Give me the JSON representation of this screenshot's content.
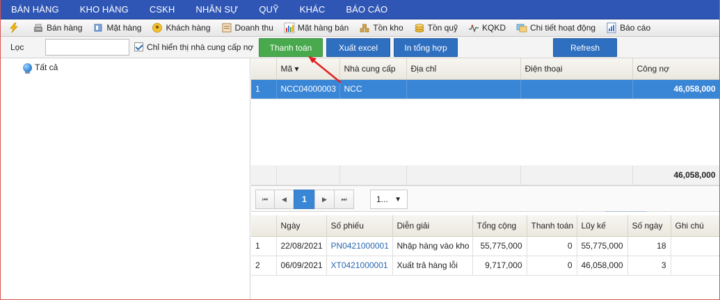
{
  "menu": [
    "BÁN HÀNG",
    "KHO HÀNG",
    "CSKH",
    "NHÂN SỰ",
    "QUỸ",
    "KHÁC",
    "BÁO CÁO"
  ],
  "toolbar": [
    {
      "label": "",
      "icon": "lightning-icon"
    },
    {
      "label": "Bán hàng",
      "icon": "cash-register-icon"
    },
    {
      "label": "Mặt hàng",
      "icon": "product-box-icon"
    },
    {
      "label": "Khách hàng",
      "icon": "customer-icon"
    },
    {
      "label": "Doanh thu",
      "icon": "revenue-icon"
    },
    {
      "label": "Mặt hàng bán",
      "icon": "sales-chart-icon"
    },
    {
      "label": "Tồn kho",
      "icon": "stock-icon"
    },
    {
      "label": "Tồn quỹ",
      "icon": "coins-icon"
    },
    {
      "label": "KQKD",
      "icon": "business-result-icon"
    },
    {
      "label": "Chi tiết hoạt động",
      "icon": "activity-icon"
    },
    {
      "label": "Báo cáo",
      "icon": "report-icon"
    }
  ],
  "filter": {
    "label": "Lọc",
    "value": "",
    "checkbox_label": "Chỉ hiển thị nhà cung cấp nợ",
    "checkbox_checked": true,
    "btn_pay": "Thanh toán",
    "btn_excel": "Xuất excel",
    "btn_print": "In tổng hợp",
    "btn_refresh": "Refresh"
  },
  "tree": {
    "root": "Tất cả"
  },
  "supplier_grid": {
    "columns": [
      "",
      "Mã ▾",
      "Nhà cung cấp",
      "Địa chỉ",
      "Điện thoại",
      "Công nợ"
    ],
    "rows": [
      {
        "no": "1",
        "code": "NCC04000003",
        "name": "NCC",
        "address": "",
        "phone": "",
        "debt": "46,058,000"
      }
    ],
    "total": "46,058,000"
  },
  "pager": {
    "current": "1",
    "page_size": "1..."
  },
  "detail_grid": {
    "columns": [
      "",
      "Ngày",
      "Số phiếu",
      "Diễn giải",
      "Tổng cộng",
      "Thanh toán",
      "Lũy kế",
      "Số ngày",
      "Ghi chú"
    ],
    "rows": [
      {
        "no": "1",
        "date": "22/08/2021",
        "voucher": "PN0421000001",
        "desc": "Nhập hàng vào kho",
        "total": "55,775,000",
        "paid": "0",
        "cumulative": "55,775,000",
        "days": "18",
        "note": ""
      },
      {
        "no": "2",
        "date": "06/09/2021",
        "voucher": "XT0421000001",
        "desc": "Xuất trả hàng lỗi",
        "total": "9,717,000",
        "paid": "0",
        "cumulative": "46,058,000",
        "days": "3",
        "note": ""
      }
    ]
  },
  "colors": {
    "menu_bg": "#2f56b5",
    "selected_row": "#3a86d6",
    "pay_button": "#48a94d",
    "action_button": "#2f6fc0",
    "annotation_arrow": "#e02020"
  }
}
